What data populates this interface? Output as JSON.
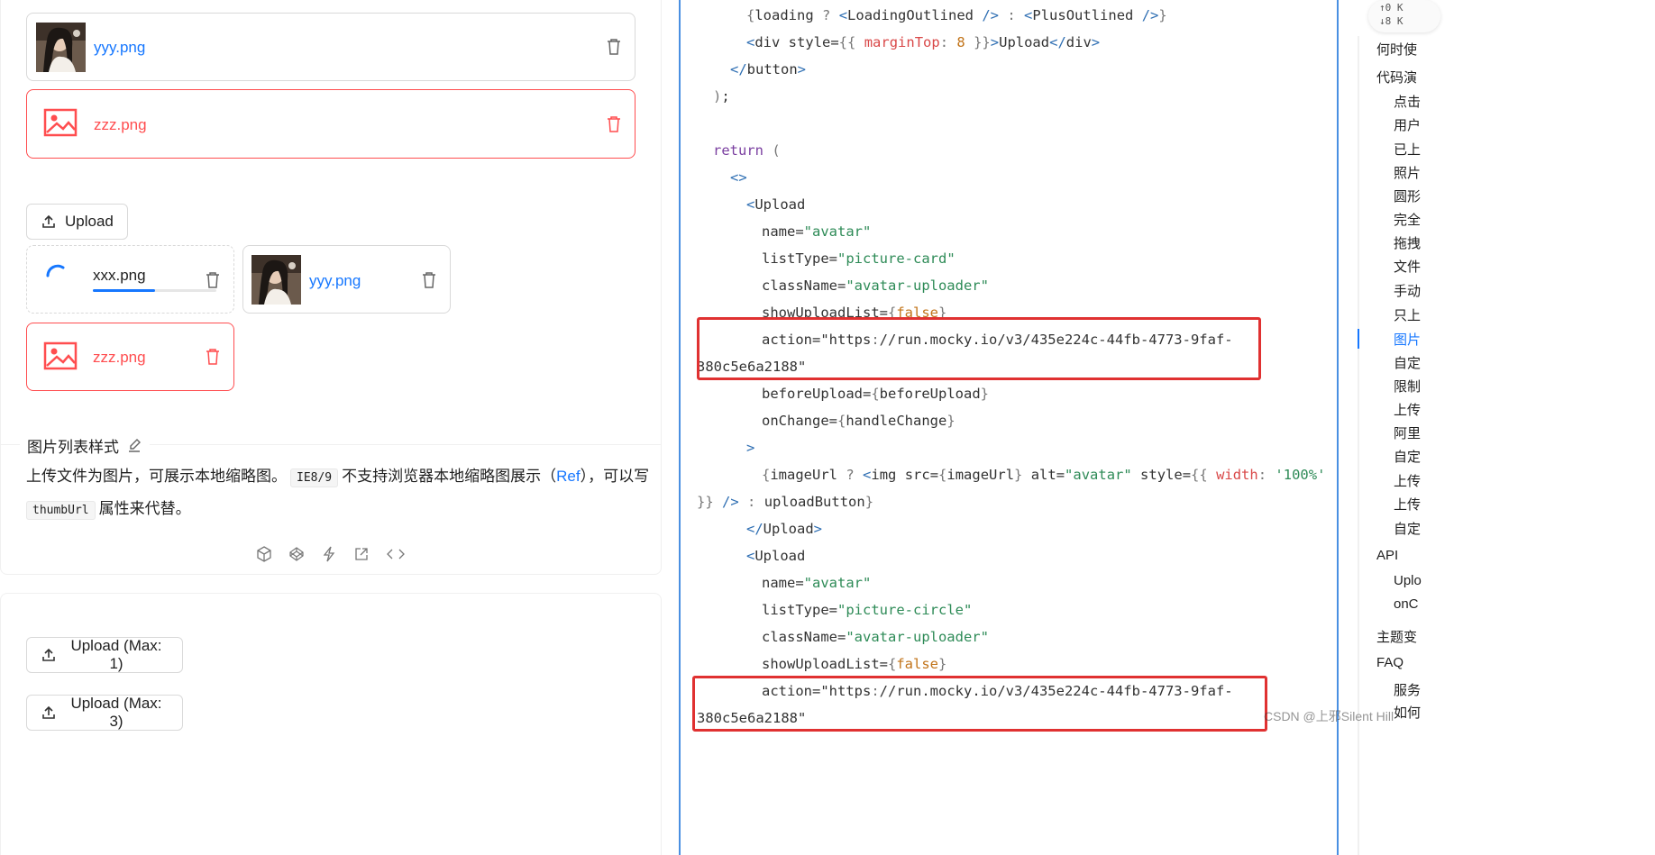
{
  "left": {
    "upload_list_1": [
      {
        "name": "yyy.png",
        "status": "done"
      },
      {
        "name": "zzz.png",
        "status": "error"
      }
    ],
    "upload_button_label": "Upload",
    "card_list": [
      {
        "name": "xxx.png",
        "status": "uploading",
        "progress": 0.5
      },
      {
        "name": "yyy.png",
        "status": "done"
      },
      {
        "name": "zzz.png",
        "status": "error"
      }
    ],
    "section_title": "图片列表样式",
    "desc_part1": "上传文件为图片，可展示本地缩略图。",
    "desc_code1": "IE8/9",
    "desc_part2": "不支持浏览器本地缩略图展示（",
    "desc_link": "Ref",
    "desc_part3": "），可以写",
    "desc_code2": "thumbUrl",
    "desc_part4": "属性来代替。",
    "action_icons": [
      "codesandbox-icon",
      "codepen-icon",
      "stackblitz-icon",
      "open-external-icon",
      "code-icon"
    ],
    "max_button_1": "Upload (Max: 1)",
    "max_button_2": "Upload (Max: 3)"
  },
  "code": {
    "lines": [
      "{loading ? <LoadingOutlined /> : <PlusOutlined />}",
      "<div style={{ marginTop: 8 }}>Upload</div>",
      "</button>",
      ");",
      "",
      "return (",
      "<>",
      "<Upload",
      "name=\"avatar\"",
      "listType=\"picture-card\"",
      "className=\"avatar-uploader\"",
      "showUploadList={false}",
      "action=\"https://run.mocky.io/v3/435e224c-44fb-4773-9faf-",
      "380c5e6a2188\"",
      "beforeUpload={beforeUpload}",
      "onChange={handleChange}",
      ">",
      "{imageUrl ? <img src={imageUrl} alt=\"avatar\" style={{ width: '100%'",
      "}} /> : uploadButton}",
      "</Upload>",
      "<Upload",
      "name=\"avatar\"",
      "listType=\"picture-circle\"",
      "className=\"avatar-uploader\"",
      "showUploadList={false}",
      "action=\"https://run.mocky.io/v3/435e224c-44fb-4773-9faf-",
      "380c5e6a2188\""
    ]
  },
  "speed": {
    "up": "↑0  K",
    "down": "↓8  K"
  },
  "nav": {
    "items": [
      {
        "label": "何时使",
        "level": 1
      },
      {
        "label": "代码演",
        "level": 1
      },
      {
        "label": "点击",
        "level": 2
      },
      {
        "label": "用户",
        "level": 2
      },
      {
        "label": "已上",
        "level": 2
      },
      {
        "label": "照片",
        "level": 2
      },
      {
        "label": "圆形",
        "level": 2
      },
      {
        "label": "完全",
        "level": 2
      },
      {
        "label": "拖拽",
        "level": 2
      },
      {
        "label": "文件",
        "level": 2
      },
      {
        "label": "手动",
        "level": 2
      },
      {
        "label": "只上",
        "level": 2
      },
      {
        "label": "图片",
        "level": 2,
        "active": true
      },
      {
        "label": "自定",
        "level": 2
      },
      {
        "label": "限制",
        "level": 2
      },
      {
        "label": "上传",
        "level": 2
      },
      {
        "label": "阿里",
        "level": 2
      },
      {
        "label": "自定",
        "level": 2
      },
      {
        "label": "上传",
        "level": 2
      },
      {
        "label": "上传",
        "level": 2
      },
      {
        "label": "自定",
        "level": 2
      },
      {
        "label": "API",
        "level": 1
      },
      {
        "label": "Uplo",
        "level": 2
      },
      {
        "label": "onC",
        "level": 2
      },
      {
        "label": "主题变",
        "level": 1
      },
      {
        "label": "FAQ",
        "level": 1
      },
      {
        "label": "服务",
        "level": 2
      },
      {
        "label": "如何",
        "level": 2
      }
    ]
  },
  "watermark": "CSDN @上邪Silent Hill"
}
